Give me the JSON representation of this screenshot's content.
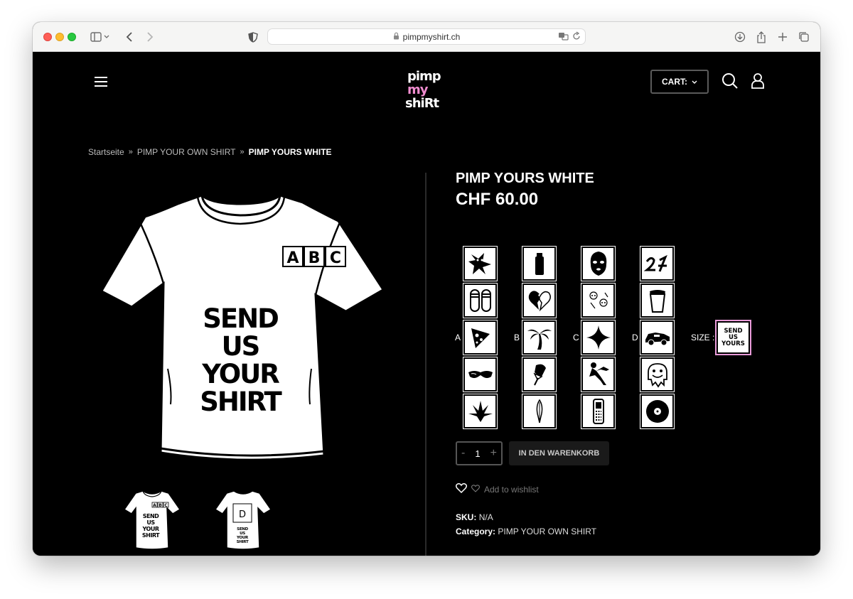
{
  "browser": {
    "url": "pimpmyshirt.ch"
  },
  "header": {
    "logo": {
      "line1": "pimp",
      "line2": "my",
      "line3": "shiRt"
    },
    "cart_label": "CART:"
  },
  "breadcrumb": {
    "items": [
      "Startseite",
      "PIMP YOUR OWN SHIRT"
    ],
    "current": "PIMP YOURS WHITE"
  },
  "shirt": {
    "abc": [
      "A",
      "B",
      "C"
    ],
    "text_lines": [
      "SEND",
      "US",
      "YOUR",
      "SHIRT"
    ],
    "back_letter": "D",
    "size_lines": [
      "SEND",
      "US",
      "YOURS"
    ]
  },
  "product": {
    "title": "PIMP YOURS WHITE",
    "price": "CHF 60.00",
    "column_labels": [
      "A",
      "B",
      "C",
      "D"
    ],
    "stickers": [
      [
        "star-figure",
        "flip-flops",
        "pizza-slice",
        "sunglasses",
        "cannabis-leaf"
      ],
      [
        "lighter",
        "broken-heart",
        "palm-tree",
        "ice-cream",
        "feather"
      ],
      [
        "balaclava",
        "skull-pair",
        "sparkle-star",
        "reclining-woman",
        "mobile-phone"
      ],
      [
        "script-21",
        "double-cup",
        "race-car",
        "smiley-drip",
        "vinyl-record"
      ]
    ],
    "size_label": "SIZE :",
    "quantity": "1",
    "qty_minus": "-",
    "qty_plus": "+",
    "add_to_cart": "IN DEN WARENKORB",
    "wishlist": "Add to wishlist",
    "sku_label": "SKU:",
    "sku_value": "N/A",
    "category_label": "Category:",
    "category_value": "PIMP YOUR OWN SHIRT"
  },
  "colors": {
    "background": "#000000",
    "logo_pink": "#f18dd0",
    "size_outline": "#e89ad8"
  }
}
